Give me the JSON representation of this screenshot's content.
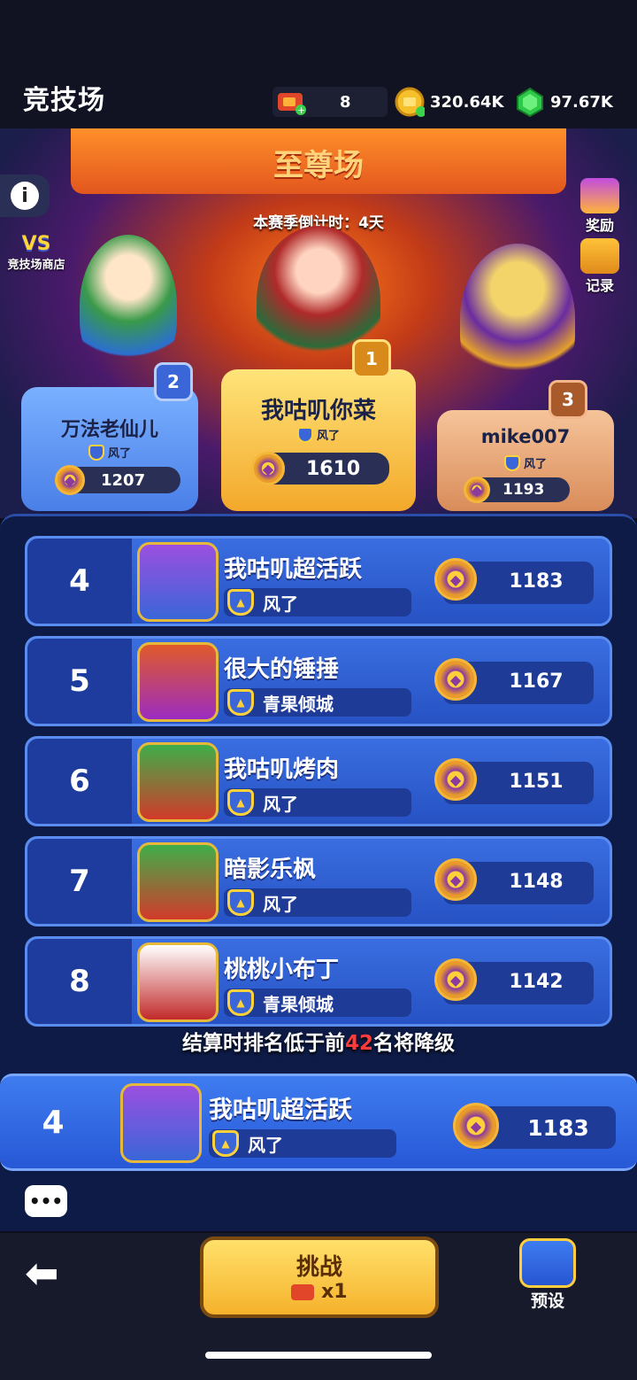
{
  "header": {
    "title": "竞技场",
    "tickets": "8",
    "gold": "320.64K",
    "gems": "97.67K"
  },
  "arena": {
    "banner": "至尊场",
    "countdown": "本赛季倒计时：4天",
    "shop_vs": "VS",
    "shop_label": "竞技场商店",
    "reward_label": "奖励",
    "record_label": "记录"
  },
  "podium": [
    {
      "rank": "1",
      "name": "我咕叽你菜",
      "guild": "风了",
      "score": "1610"
    },
    {
      "rank": "2",
      "name": "万法老仙儿",
      "guild": "风了",
      "score": "1207"
    },
    {
      "rank": "3",
      "name": "mike007",
      "guild": "风了",
      "score": "1193"
    }
  ],
  "rows": [
    {
      "rank": "4",
      "name": "我咕叽超活跃",
      "guild": "风了",
      "score": "1183"
    },
    {
      "rank": "5",
      "name": "很大的锤捶",
      "guild": "青果倾城",
      "score": "1167"
    },
    {
      "rank": "6",
      "name": "我咕叽烤肉",
      "guild": "风了",
      "score": "1151"
    },
    {
      "rank": "7",
      "name": "暗影乐枫",
      "guild": "风了",
      "score": "1148"
    },
    {
      "rank": "8",
      "name": "桃桃小布丁",
      "guild": "青果倾城",
      "score": "1142"
    }
  ],
  "warning": {
    "prefix": "结算时排名低于前",
    "number": "42",
    "suffix": "名将降级"
  },
  "me": {
    "rank": "4",
    "name": "我咕叽超活跃",
    "guild": "风了",
    "score": "1183"
  },
  "bottom": {
    "challenge_label": "挑战",
    "challenge_cost": "x1",
    "preset_label": "预设",
    "back_icon": "back-arrow-icon"
  },
  "colors": {
    "row_blue": "#2652c4",
    "gold": "#f5b22c",
    "warn_red": "#ff3b3b"
  }
}
